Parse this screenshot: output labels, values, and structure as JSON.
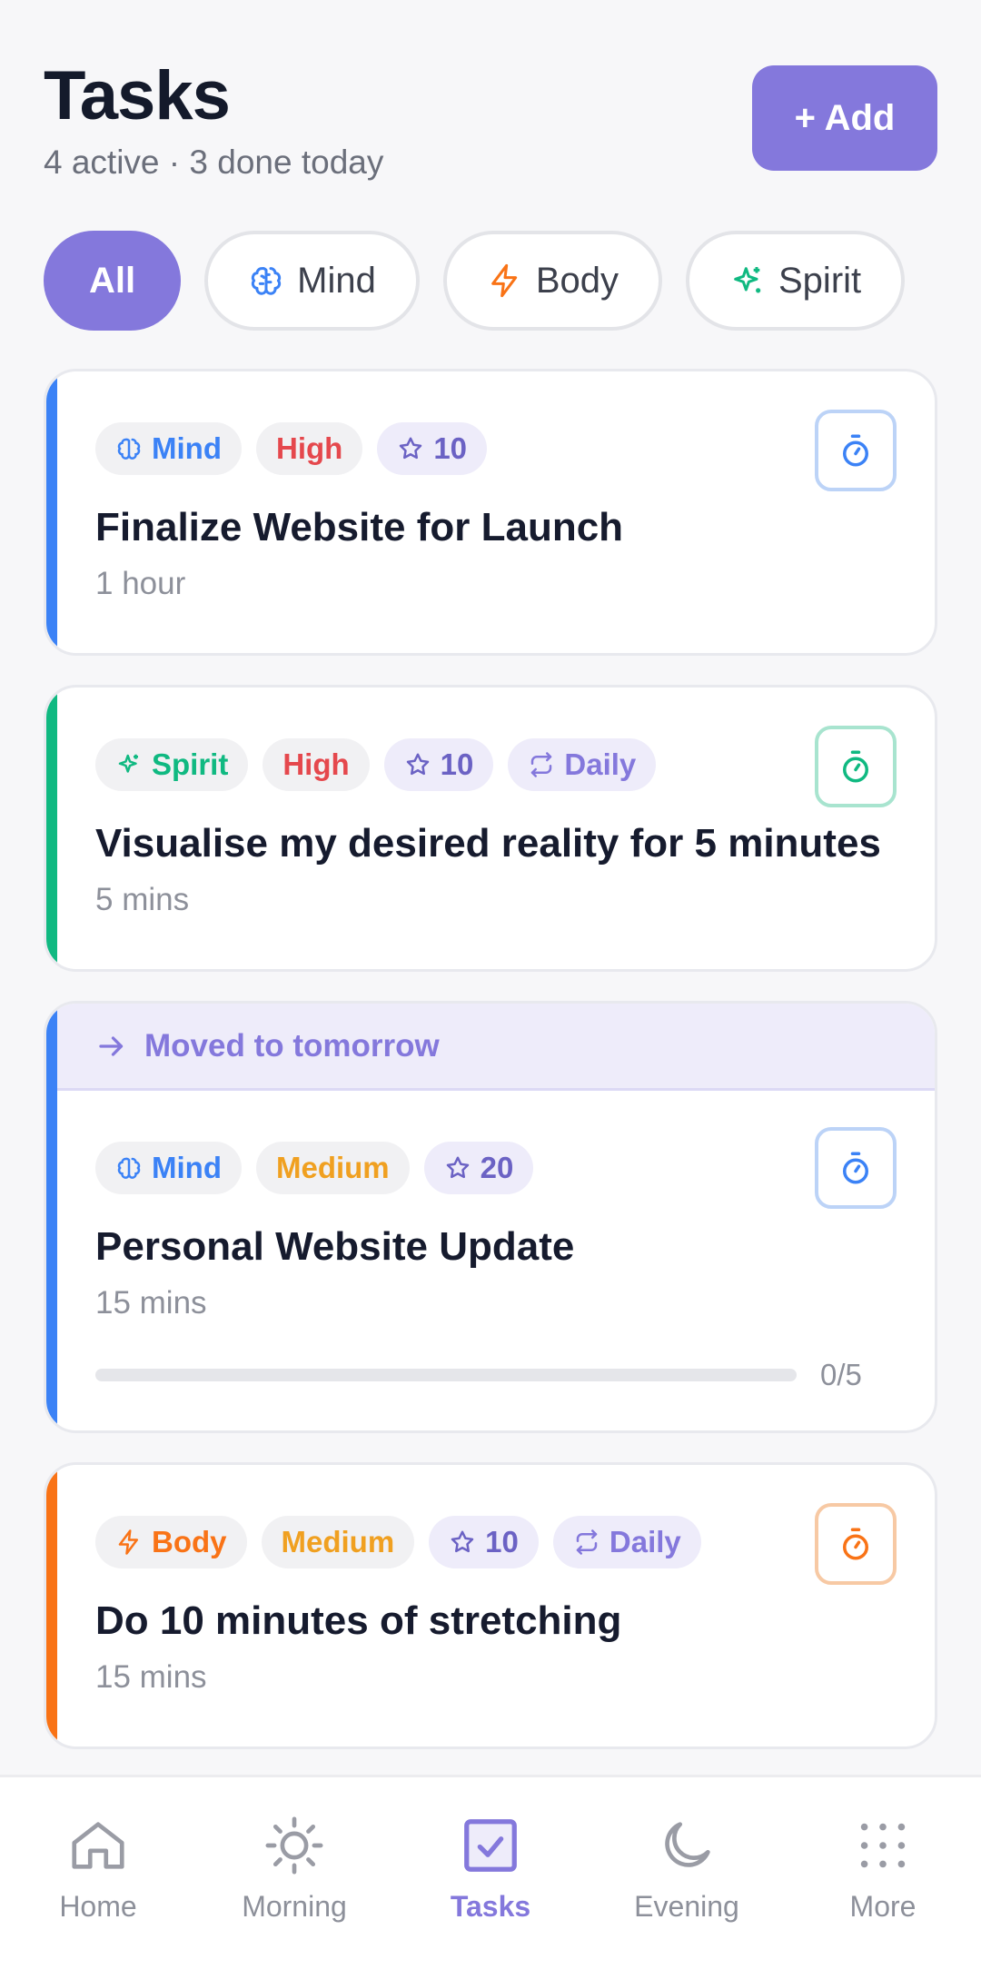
{
  "header": {
    "title": "Tasks",
    "subtitle": "4 active · 3 done today",
    "add_label": "+ Add"
  },
  "filters": [
    {
      "label": "All",
      "icon": "none",
      "active": true
    },
    {
      "label": "Mind",
      "icon": "brain-icon",
      "color": "#3b82f6"
    },
    {
      "label": "Body",
      "icon": "bolt-icon",
      "color": "#f97316"
    },
    {
      "label": "Spirit",
      "icon": "sparkle-icon",
      "color": "#10b981"
    }
  ],
  "colors": {
    "accent": "#8478dc",
    "mind": "#3b82f6",
    "body": "#f97316",
    "spirit": "#10b981",
    "high": "#e5484d",
    "medium": "#f0a020"
  },
  "tasks": [
    {
      "category": "Mind",
      "priority": "High",
      "points": "10",
      "title": "Finalize Website for Launch",
      "duration": "1 hour"
    },
    {
      "category": "Spirit",
      "priority": "High",
      "points": "10",
      "recurrence": "Daily",
      "title": "Visualise my desired reality for 5 minutes",
      "duration": "5 mins"
    },
    {
      "banner": "Moved to tomorrow",
      "category": "Mind",
      "priority": "Medium",
      "points": "20",
      "title": "Personal Website Update",
      "duration": "15 mins",
      "progress_text": "0/5",
      "progress": 0
    },
    {
      "category": "Body",
      "priority": "Medium",
      "points": "10",
      "recurrence": "Daily",
      "title": "Do 10 minutes of stretching",
      "duration": "15 mins"
    }
  ],
  "nav": [
    {
      "label": "Home",
      "icon": "home-icon"
    },
    {
      "label": "Morning",
      "icon": "sun-icon"
    },
    {
      "label": "Tasks",
      "icon": "checkbox-icon",
      "active": true
    },
    {
      "label": "Evening",
      "icon": "moon-icon"
    },
    {
      "label": "More",
      "icon": "grid-dots-icon"
    }
  ]
}
